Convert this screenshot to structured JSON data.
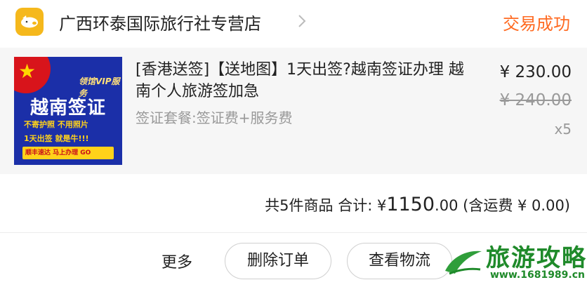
{
  "store": {
    "name": "广西环泰国际旅行社专营店",
    "status": "交易成功"
  },
  "product": {
    "thumbnail": {
      "vip_text": "领馆VIP服务",
      "title": "越南签证",
      "line1": "不寄护照 不用照片",
      "line2": "1天出签 就是牛!!!",
      "cta": "顺丰速达 马上办理 GO"
    },
    "title": "[香港送签]【送地图】1天出签?越南签证办理 越南个人旅游签加急",
    "spec": "签证套餐:签证费+服务费",
    "price_current": "¥ 230.00",
    "price_original": "¥ 240.00",
    "quantity": "x5"
  },
  "summary": {
    "count_label": "共5件商品 合计: ¥",
    "total_major": "1150",
    "total_minor": ".00",
    "shipping": "(含运费 ¥ 0.00)"
  },
  "actions": {
    "more": "更多",
    "delete": "删除订单",
    "logistics": "查看物流"
  },
  "watermark": {
    "text": "旅游攻略",
    "url": "www.1681989.cn"
  },
  "colors": {
    "accent": "#ff6a21",
    "logo_bg": "#f5b81c",
    "watermark": "#1f8a2a"
  }
}
